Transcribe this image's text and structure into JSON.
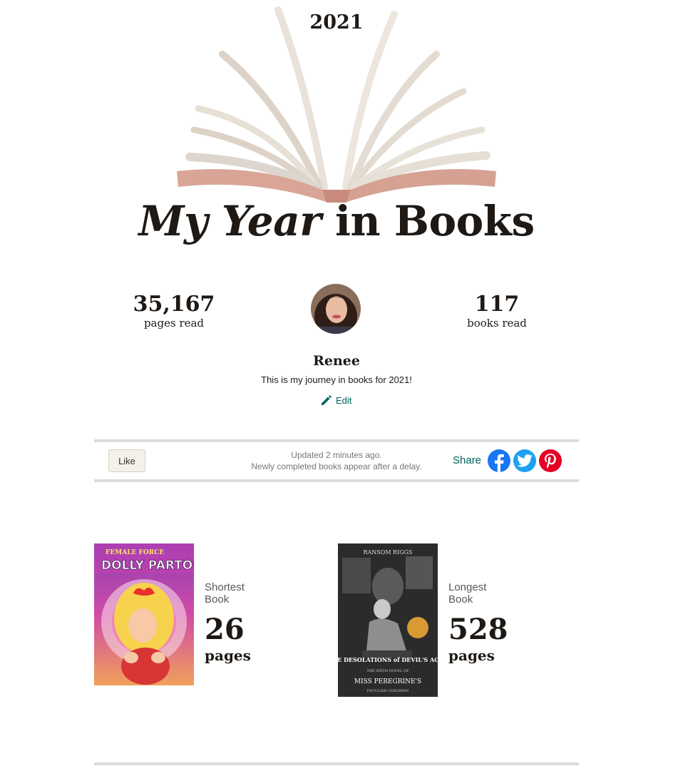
{
  "header": {
    "year": "2021",
    "title_italic": "My Year",
    "title_rest": " in Books"
  },
  "stats": {
    "pages_count": "35,167",
    "pages_label": "pages read",
    "books_count": "117",
    "books_label": "books read"
  },
  "profile": {
    "name": "Renee",
    "description": "This is my journey in books for 2021!",
    "edit_label": "Edit"
  },
  "action_bar": {
    "like_label": "Like",
    "updated_line1": "Updated 2 minutes ago.",
    "updated_line2": "Newly completed books appear after a delay.",
    "share_label": "Share"
  },
  "books": {
    "shortest": {
      "kind": "Shortest Book",
      "pages": "26",
      "pages_label": "pages",
      "cover_series": "FEMALE FORCE",
      "cover_title": "DOLLY PARTON"
    },
    "longest": {
      "kind": "Longest Book",
      "pages": "528",
      "pages_label": "pages",
      "cover_author": "RANSOM RIGGS",
      "cover_title": "THE DESOLATIONS of DEVIL'S ACRE",
      "cover_subtitle": "THE SIXTH NOVEL OF",
      "cover_series": "MISS PEREGRINE'S",
      "cover_series_sub": "PECULIAR CHILDREN"
    }
  },
  "colors": {
    "accent": "#00635d",
    "facebook": "#1877f2",
    "twitter": "#1da1f2",
    "pinterest": "#e60023"
  }
}
